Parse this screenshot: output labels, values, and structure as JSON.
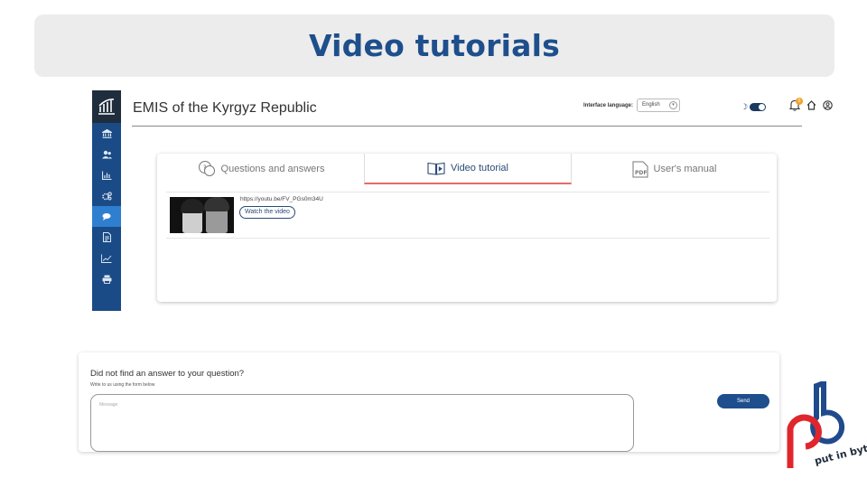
{
  "banner": {
    "title": "Video tutorials"
  },
  "app": {
    "title": "EMIS of the Kyrgyz Republic",
    "interface_language_label": "Interface language:",
    "language_value": "English",
    "notification_count": "0",
    "sidebar_items": [
      "building-icon",
      "users-icon",
      "chart-icon",
      "settings-icon",
      "chat-icon",
      "document-icon",
      "trend-icon",
      "print-icon"
    ],
    "active_sidebar_index": 4
  },
  "tabs": [
    {
      "label": "Questions and answers",
      "icon": "question-bubble-icon",
      "active": false
    },
    {
      "label": "Video tutorial",
      "icon": "video-book-icon",
      "active": true
    },
    {
      "label": "User's manual",
      "icon": "pdf-icon",
      "active": false
    }
  ],
  "video": {
    "url": "https://youtu.be/FV_PGs0m34U",
    "watch_label": "Watch the video"
  },
  "feedback": {
    "title": "Did not find an answer to your question?",
    "subtitle": "Write to us using the form below",
    "placeholder": "Message",
    "send_label": "Send"
  },
  "brand": {
    "logo_text": "put in byte"
  },
  "colors": {
    "banner_title": "#1e4f8c",
    "sidebar": "#1a4b86",
    "active_tab_underline": "#e86a6a",
    "brand_red": "#e0262d",
    "brand_blue": "#1f4a8c"
  }
}
